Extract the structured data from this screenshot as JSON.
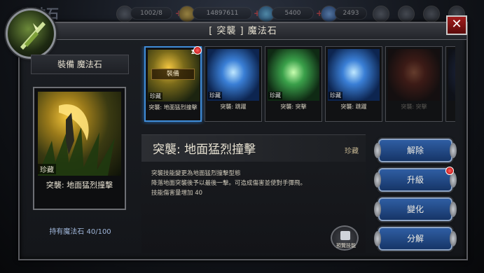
{
  "hud": {
    "bg_title": "魔法石",
    "res1": "1002/8",
    "gold": "14897611",
    "gem": "5400",
    "res4": "2493"
  },
  "window": {
    "title": "[ 突襲 ] 魔法石",
    "close": "✕"
  },
  "left": {
    "header": "裝備 魔法石",
    "rarity": "珍藏",
    "name": "突襲: 地面猛烈撞擊",
    "own_count": "持有魔法石 40/100"
  },
  "stones": [
    {
      "tag": "珍藏",
      "label": "突襲: 地面猛烈撞擊",
      "equip": "裝備",
      "num": "1",
      "selected": true
    },
    {
      "tag": "珍藏",
      "label": "突襲: 跳躍"
    },
    {
      "tag": "珍藏",
      "label": "突襲: 突擊"
    },
    {
      "tag": "珍藏",
      "label": "突襲: 跳躍"
    },
    {
      "tag": "珍藏",
      "label": "突襲: 突擊"
    }
  ],
  "detail": {
    "title": "突襲: 地面猛烈撞擊",
    "rarity": "珍藏",
    "lines": [
      "突襲技能變更為地面猛烈撞擊型態",
      "降落地面突襲後予以最後一擊。可造成傷害並使對手彈飛。",
      "技能傷害量增加 40"
    ],
    "preview_label": "預覽技能"
  },
  "buttons": {
    "release": "解除",
    "upgrade": "升級",
    "change": "變化",
    "decompose": "分解"
  },
  "colors": {
    "accent_blue": "#2f5ea3",
    "close_red": "#a21d1d",
    "notify_red": "#ff3030",
    "selected_border": "#3f8cd8"
  }
}
